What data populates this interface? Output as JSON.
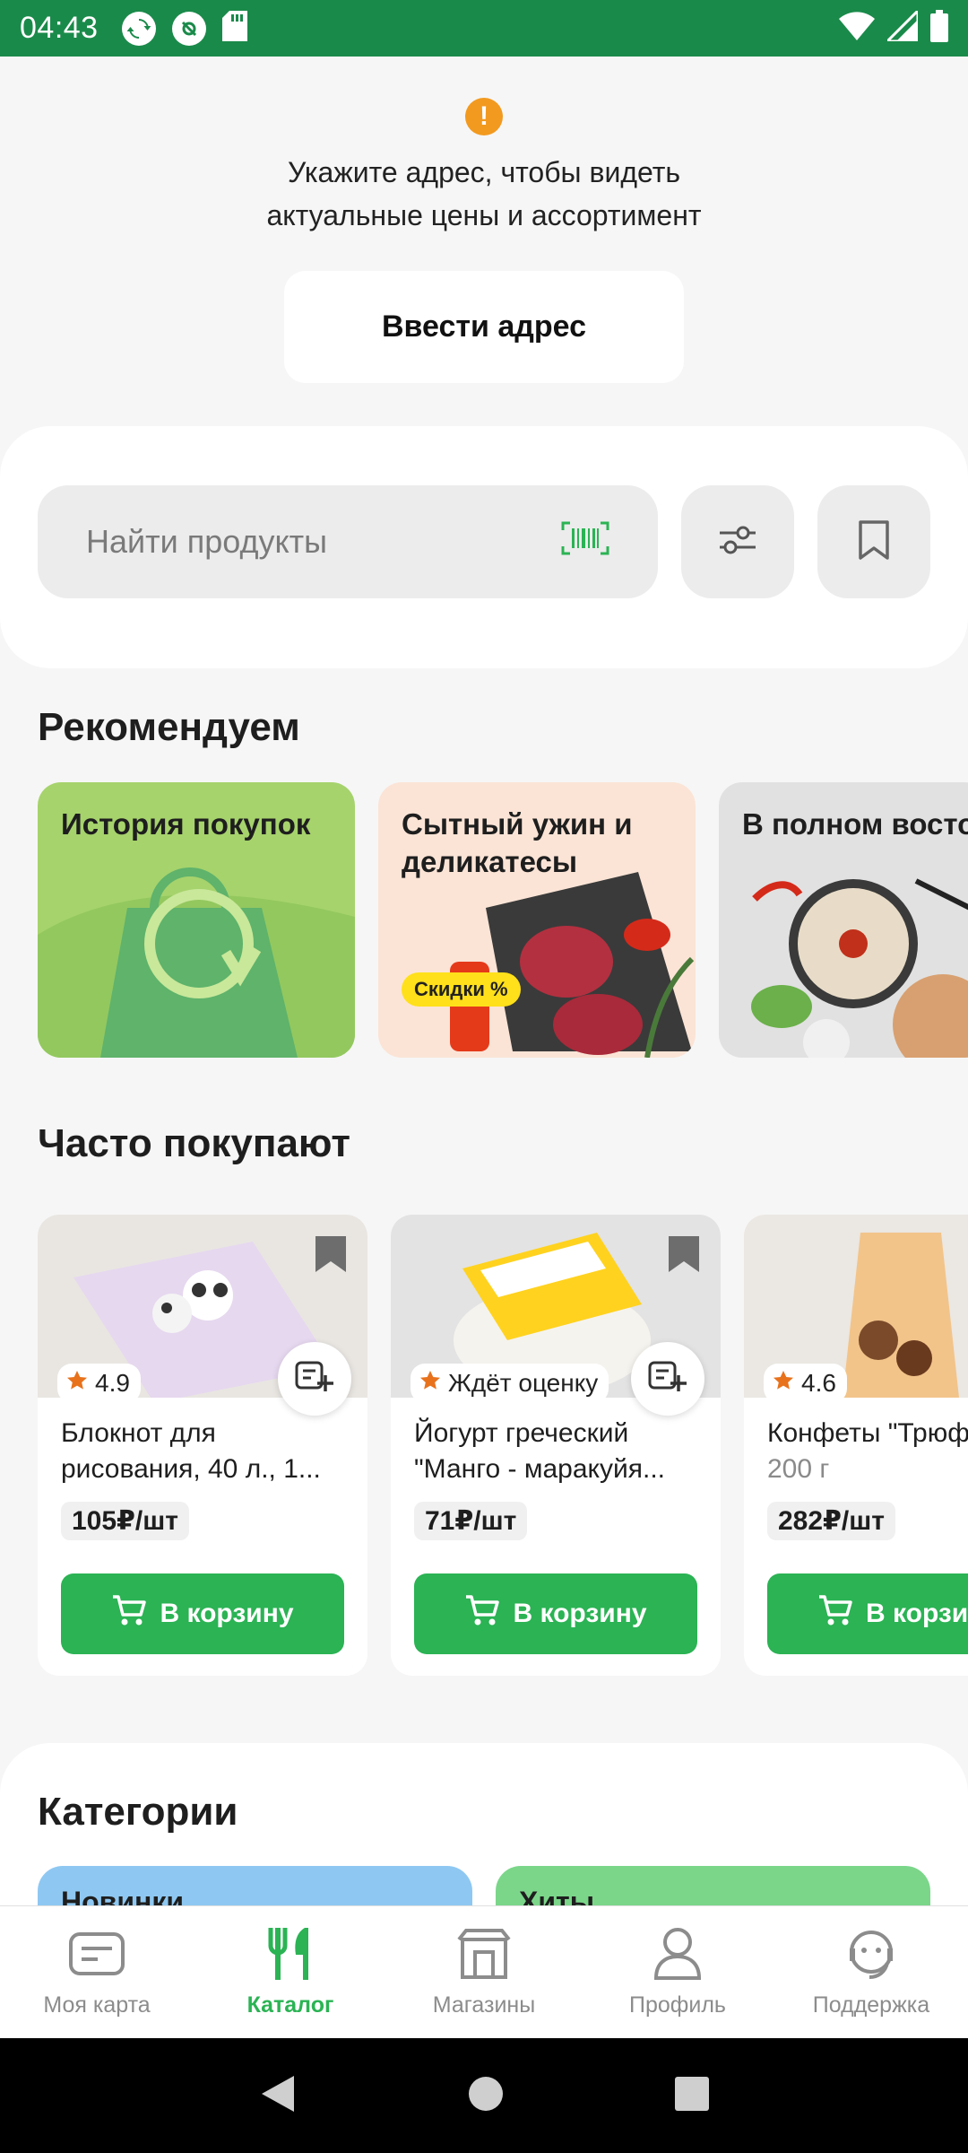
{
  "status_bar": {
    "time": "04:43"
  },
  "address_prompt": {
    "warning_glyph": "!",
    "line1": "Укажите адрес, чтобы видеть",
    "line2": "актуальные цены и ассортимент",
    "button_label": "Ввести адрес"
  },
  "search": {
    "placeholder": "Найти продукты"
  },
  "recommend": {
    "title": "Рекомендуем",
    "cards": [
      {
        "title": "История покупок"
      },
      {
        "title": "Сытный ужин и деликатесы",
        "badge": "Скидки %"
      },
      {
        "title": "В полном восто"
      }
    ]
  },
  "frequent": {
    "title": "Часто покупают",
    "products": [
      {
        "rating": "4.9",
        "name_line1": "Блокнот для",
        "name_line2": "рисования, 40 л., 1...",
        "price": "105₽/шт",
        "cart_label": "В корзину"
      },
      {
        "rating": "Ждёт оценку",
        "name_line1": "Йогурт греческий",
        "name_line2": "\"Манго - маракуйя...",
        "price": "71₽/шт",
        "cart_label": "В корзину"
      },
      {
        "rating": "4.6",
        "name_line1": "Конфеты \"Трюф",
        "name_line2": "200 г",
        "price": "282₽/шт",
        "cart_label": "В корзин"
      }
    ]
  },
  "categories": {
    "title": "Категории",
    "tiles": [
      {
        "label": "Новинки"
      },
      {
        "label": "Хиты"
      }
    ]
  },
  "bottom_nav": {
    "items": [
      {
        "label": "Моя карта",
        "icon": "card-icon"
      },
      {
        "label": "Каталог",
        "icon": "fork-knife-icon",
        "active": true
      },
      {
        "label": "Магазины",
        "icon": "store-icon"
      },
      {
        "label": "Профиль",
        "icon": "person-icon"
      },
      {
        "label": "Поддержка",
        "icon": "support-icon"
      }
    ]
  },
  "colors": {
    "brand_green": "#1a8a4a",
    "button_green": "#2bb354",
    "warning_orange": "#f29a1f",
    "badge_yellow": "#ffe01a"
  }
}
